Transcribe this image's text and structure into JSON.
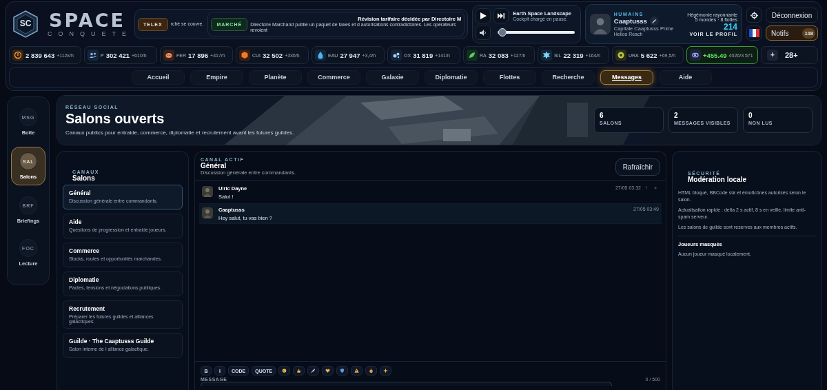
{
  "logo": {
    "badge": "SC",
    "title": "SPACE",
    "subtitle": "CONQUETE"
  },
  "ticker": [
    {
      "kind": "telex",
      "tag": "TELEX",
      "text": "rché se couvre."
    },
    {
      "kind": "market",
      "tag": "MARCHÉ",
      "title": "Révision tarifaire décidée par Directoire M",
      "text": "Directoire Marchand publie un paquet de taxes et d autorisations contradictoires. Les opérateurs revoient"
    }
  ],
  "player": {
    "title": "Earth Space Landscape",
    "status": "Cockpit chargé en pause.",
    "playing": false,
    "level": 0.06
  },
  "profile": {
    "race": "HUMAINS",
    "name": "Caaptusss",
    "capital": "Capitale Caaptusss Prime",
    "sector": "Helios Reach",
    "rank": "Hégémonie rayonnante",
    "holdings": "5 mondes · 8 flottes",
    "score": "214",
    "link": "VOIR LE PROFIL"
  },
  "account": {
    "logout": "Déconnexion",
    "notifs": "Notifs",
    "notif_count": "108"
  },
  "resources": [
    {
      "kind": "credits",
      "value": "2 839 643",
      "rate": "+112k/h"
    },
    {
      "kind": "population",
      "label": "P",
      "value": "302 421",
      "rate": "+610/h"
    },
    {
      "kind": "iron",
      "label": "FER",
      "value": "17 896",
      "rate": "+417/h"
    },
    {
      "kind": "copper",
      "label": "CUI",
      "value": "32 502",
      "rate": "+336/h"
    },
    {
      "kind": "water",
      "label": "EAU",
      "value": "27 947",
      "rate": "+3,4/h"
    },
    {
      "kind": "oxygen",
      "label": "OX",
      "value": "31 819",
      "rate": "+141/h"
    },
    {
      "kind": "radium",
      "label": "RA",
      "value": "32 083",
      "rate": "+127/h"
    },
    {
      "kind": "silicon",
      "label": "SIL",
      "value": "22 319",
      "rate": "+164/h"
    },
    {
      "kind": "uranium",
      "label": "URA",
      "value": "5 622",
      "rate": "+69,5/h"
    },
    {
      "kind": "energy",
      "value": "+455.49",
      "rate": "4026/3 571"
    },
    {
      "kind": "more",
      "symbol": "+",
      "value": "28+"
    }
  ],
  "nav": [
    {
      "label": "Accueil",
      "selected": false
    },
    {
      "label": "Empire",
      "selected": false
    },
    {
      "label": "Planète",
      "selected": false
    },
    {
      "label": "Commerce",
      "selected": false
    },
    {
      "label": "Galaxie",
      "selected": false
    },
    {
      "label": "Diplomatie",
      "selected": false
    },
    {
      "label": "Flottes",
      "selected": false
    },
    {
      "label": "Recherche",
      "selected": false
    },
    {
      "label": "Messages",
      "selected": true
    },
    {
      "label": "Aide",
      "selected": false
    }
  ],
  "sidebar": [
    {
      "code": "MSG",
      "label": "Boîte",
      "selected": false
    },
    {
      "code": "SAL",
      "label": "Salons",
      "selected": true
    },
    {
      "code": "BRF",
      "label": "Briefings",
      "selected": false
    },
    {
      "code": "FOC",
      "label": "Lecture",
      "selected": false
    }
  ],
  "banner": {
    "eyebrow": "RÉSEAU SOCIAL",
    "title": "Salons ouverts",
    "description": "Canaux publics pour entraide, commerce, diplomatie et recrutement avant les futures guildes.",
    "stats": [
      {
        "value": "6",
        "label": "SALONS"
      },
      {
        "value": "2",
        "label": "MESSAGES VISIBLES"
      },
      {
        "value": "0",
        "label": "NON LUS"
      }
    ]
  },
  "channels": {
    "eyebrow": "CANAUX",
    "title": "Salons",
    "items": [
      {
        "title": "Général",
        "description": "Discussion générale entre commandants.",
        "selected": true
      },
      {
        "title": "Aide",
        "description": "Questions de progression et entraide joueurs.",
        "selected": false
      },
      {
        "title": "Commerce",
        "description": "Stocks, routes et opportunités marchandes.",
        "selected": false
      },
      {
        "title": "Diplomatie",
        "description": "Pactes, tensions et négociations publiques.",
        "selected": false
      },
      {
        "title": "Recrutement",
        "description": "Préparer les futures guildes et alliances galactiques.",
        "selected": false
      },
      {
        "title": "Guilde · The Caaptusss Guilde",
        "description": "Salon interne de l alliance galactique.",
        "selected": false
      }
    ]
  },
  "chat": {
    "eyebrow": "CANAL ACTIF",
    "title": "Général",
    "description": "Discussion générale entre commandants.",
    "refresh": "Rafraîchir",
    "messages": [
      {
        "author": "Ulric Dayne",
        "text": "Salut !",
        "time": "27/05 03:32",
        "own": false,
        "actions": [
          "!",
          "×"
        ]
      },
      {
        "author": "Caaptusss",
        "text": "Hey salut, tu vas bien ?",
        "time": "27/05 03:49",
        "own": true
      }
    ],
    "toolbar": [
      {
        "kind": "text",
        "label": "B"
      },
      {
        "kind": "text",
        "label": "I"
      },
      {
        "kind": "text",
        "label": "CODE"
      },
      {
        "kind": "text",
        "label": "QUOTE"
      },
      {
        "kind": "emoji"
      },
      {
        "kind": "emoji"
      },
      {
        "kind": "emoji"
      },
      {
        "kind": "emoji"
      },
      {
        "kind": "emoji"
      },
      {
        "kind": "emoji"
      },
      {
        "kind": "emoji"
      },
      {
        "kind": "emoji"
      }
    ],
    "message_label": "MESSAGE",
    "counter": "0 / 500"
  },
  "moderation": {
    "eyebrow": "SÉCURITÉ",
    "title": "Modération locale",
    "paragraphs": [
      "HTML bloqué, BBCode sûr et émoticônes autorisés selon le salon.",
      "Actualisation rapide : delta 2 s actif, 8 s en veille, limite anti-spam serveur.",
      "Les salons de guilde sont reserves aux membres actifs."
    ],
    "masked_title": "Joueurs masqués",
    "masked_text": "Aucun joueur masqué localement."
  }
}
